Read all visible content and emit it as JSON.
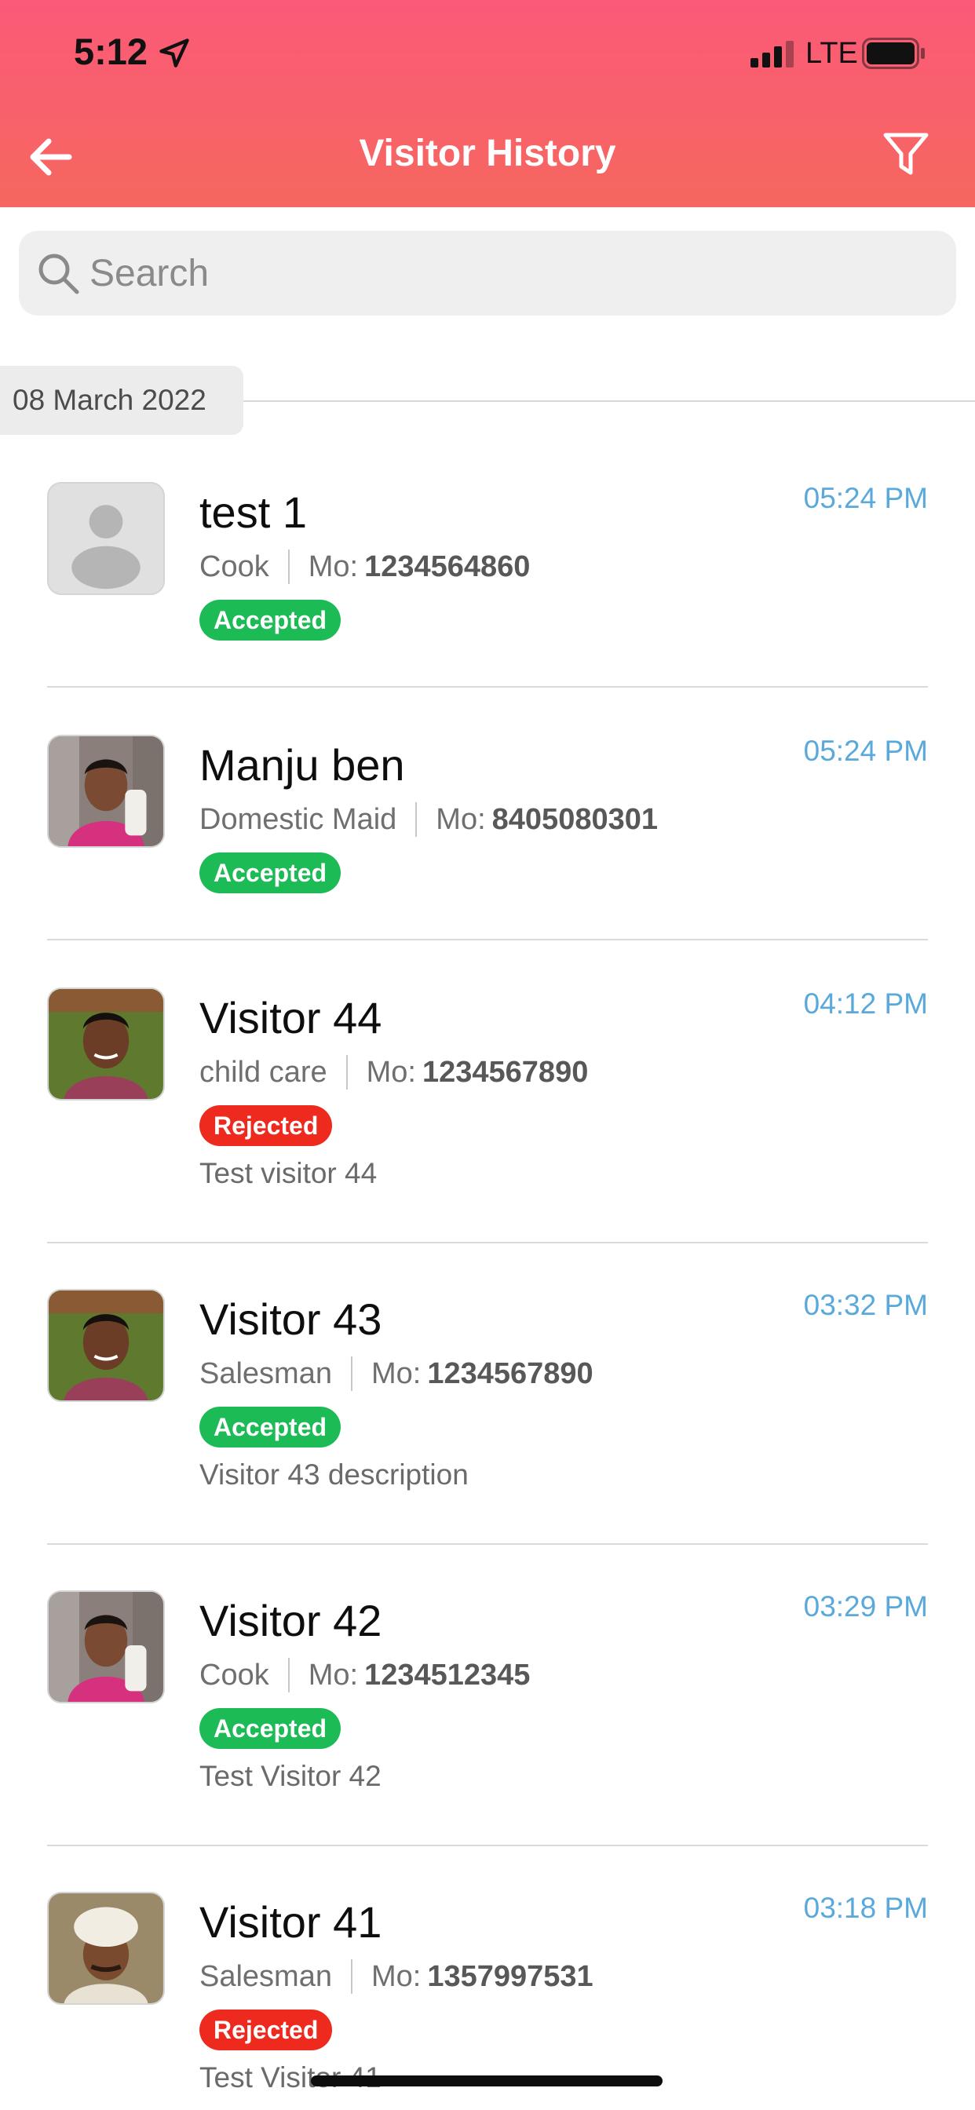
{
  "status_bar": {
    "time": "5:12",
    "network": "LTE"
  },
  "header": {
    "title": "Visitor History"
  },
  "search": {
    "placeholder": "Search",
    "value": ""
  },
  "date_group": "08 March 2022",
  "colors": {
    "header_start": "#fb5a78",
    "header_end": "#f6675f",
    "time_blue": "#5aa9dc",
    "accepted_green": "#1dbb56",
    "rejected_red": "#ee2a1f"
  },
  "mo_label": "Mo:",
  "visitors": [
    {
      "name": "test 1",
      "category": "Cook",
      "mobile": "1234564860",
      "time": "05:24 PM",
      "status": "Accepted",
      "description": "",
      "avatar": "placeholder-person-icon"
    },
    {
      "name": "Manju ben",
      "category": "Domestic Maid",
      "mobile": "8405080301",
      "time": "05:24 PM",
      "status": "Accepted",
      "description": "",
      "avatar": "woman-photo"
    },
    {
      "name": "Visitor 44",
      "category": "child care",
      "mobile": "1234567890",
      "time": "04:12 PM",
      "status": "Rejected",
      "description": "Test visitor 44",
      "avatar": "man-photo"
    },
    {
      "name": "Visitor 43",
      "category": "Salesman",
      "mobile": "1234567890",
      "time": "03:32 PM",
      "status": "Accepted",
      "description": "Visitor 43 description",
      "avatar": "man-photo"
    },
    {
      "name": "Visitor 42",
      "category": "Cook",
      "mobile": "1234512345",
      "time": "03:29 PM",
      "status": "Accepted",
      "description": "Test Visitor 42",
      "avatar": "woman-photo"
    },
    {
      "name": "Visitor 41",
      "category": "Salesman",
      "mobile": "1357997531",
      "time": "03:18 PM",
      "status": "Rejected",
      "description": "Test Visitor 41",
      "avatar": "turban-man-photo"
    }
  ]
}
